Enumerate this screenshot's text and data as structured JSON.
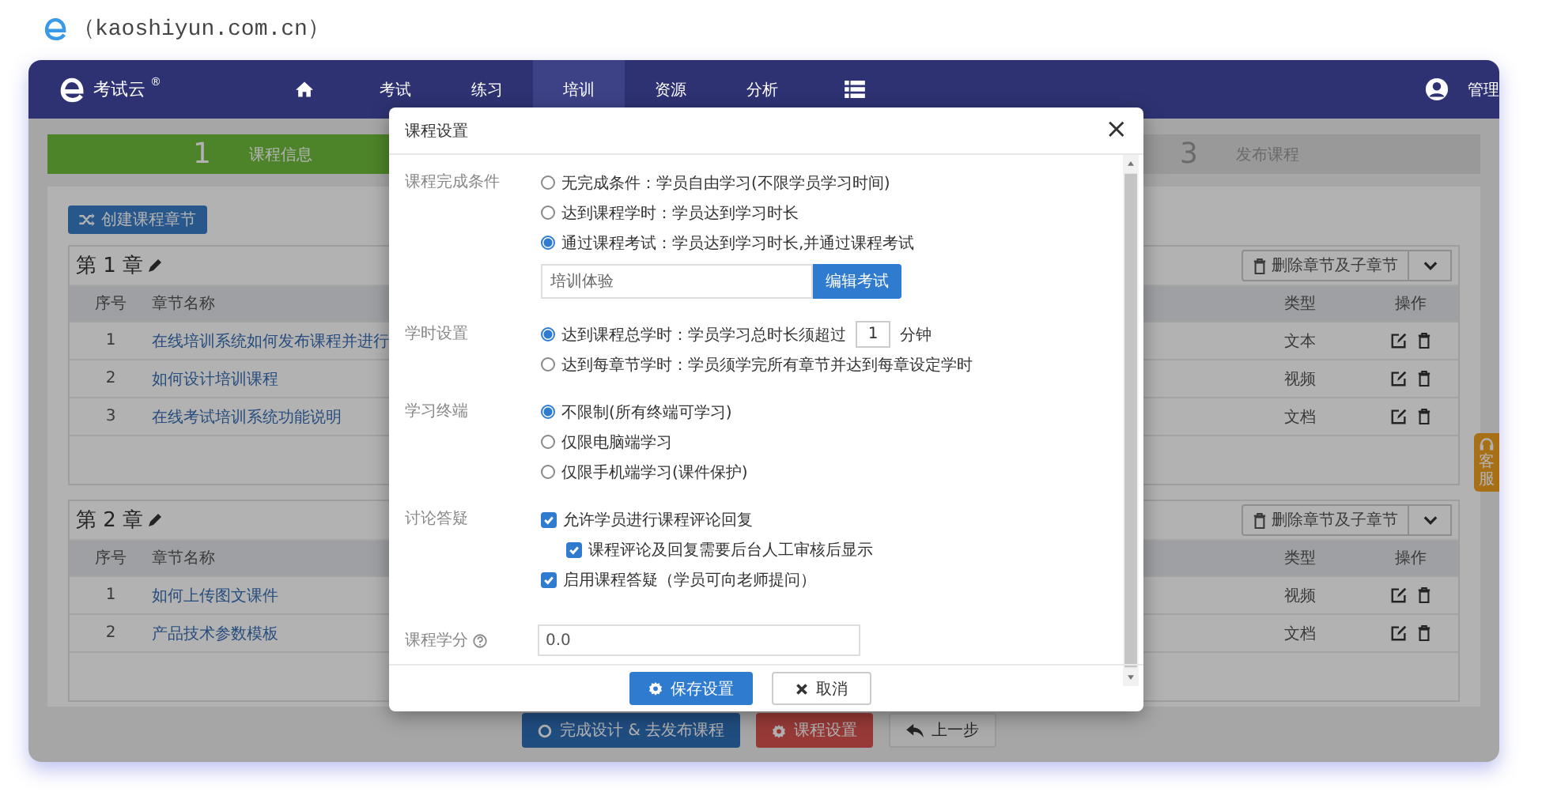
{
  "caption": {
    "text": "（kaoshiyun.com.cn）"
  },
  "navbar": {
    "brand": "考试云",
    "brand_mark": "®",
    "items": [
      {
        "kind": "home",
        "selected": false
      },
      {
        "kind": "text",
        "label": "考试",
        "selected": false
      },
      {
        "kind": "text",
        "label": "练习",
        "selected": false
      },
      {
        "kind": "text",
        "label": "培训",
        "selected": true
      },
      {
        "kind": "text",
        "label": "资源",
        "selected": false
      },
      {
        "kind": "text",
        "label": "分析",
        "selected": false
      },
      {
        "kind": "menu",
        "selected": false
      }
    ],
    "user_label": "管理"
  },
  "steps": [
    {
      "number": "1",
      "label": "课程信息",
      "selected": true
    },
    {
      "number": "3",
      "label": "发布课程",
      "selected": false
    }
  ],
  "create_chapter_button": "创建课程章节",
  "chapters": [
    {
      "title": "第 1 章",
      "delete_button": "删除章节及子章节",
      "columns": [
        "序号",
        "章节名称",
        "类型",
        "操作"
      ],
      "rows": [
        {
          "index": "1",
          "name": "在线培训系统如何发布课程并进行",
          "type": "文本"
        },
        {
          "index": "2",
          "name": "如何设计培训课程",
          "type": "视频"
        },
        {
          "index": "3",
          "name": "在线考试培训系统功能说明",
          "type": "文档"
        }
      ]
    },
    {
      "title": "第 2 章",
      "delete_button": "删除章节及子章节",
      "columns": [
        "序号",
        "章节名称",
        "类型",
        "操作"
      ],
      "rows": [
        {
          "index": "1",
          "name": "如何上传图文课件",
          "type": "视频"
        },
        {
          "index": "2",
          "name": "产品技术参数模板",
          "type": "文档"
        }
      ]
    }
  ],
  "bottom_buttons": [
    {
      "kind": "finish",
      "label": "完成设计 & 去发布课程"
    },
    {
      "kind": "settings",
      "label": "课程设置"
    },
    {
      "kind": "back",
      "label": "上一步"
    }
  ],
  "side_tab": {
    "label": "客服"
  },
  "modal": {
    "title": "课程设置",
    "close": "×",
    "sections": [
      {
        "label": "课程完成条件",
        "options": [
          {
            "kind": "radio",
            "label": "无完成条件：学员自由学习(不限学员学习时间)",
            "selected": false
          },
          {
            "kind": "radio",
            "label": "达到课程学时：学员达到学习时长",
            "selected": false
          },
          {
            "kind": "radio",
            "label": "通过课程考试：学员达到学习时长,并通过课程考试",
            "selected": true
          }
        ],
        "exam": {
          "value": "培训体验",
          "button": "编辑考试"
        }
      },
      {
        "label": "学时设置",
        "options": [
          {
            "kind": "radio",
            "label": "达到课程总学时：学员学习总时长须超过",
            "selected": true,
            "input": "1",
            "suffix": "分钟"
          },
          {
            "kind": "radio",
            "label": "达到每章节学时：学员须学完所有章节并达到每章设定学时",
            "selected": false
          }
        ]
      },
      {
        "label": "学习终端",
        "options": [
          {
            "kind": "radio",
            "label": "不限制(所有终端可学习)",
            "selected": true
          },
          {
            "kind": "radio",
            "label": "仅限电脑端学习",
            "selected": false
          },
          {
            "kind": "radio",
            "label": "仅限手机端学习(课件保护)",
            "selected": false
          }
        ]
      },
      {
        "label": "讨论答疑",
        "options": [
          {
            "kind": "checkbox",
            "label": "允许学员进行课程评论回复",
            "checked": true,
            "children": [
              {
                "kind": "checkbox",
                "label": "课程评论及回复需要后台人工审核后显示",
                "checked": true
              }
            ]
          },
          {
            "kind": "checkbox",
            "label": "启用课程答疑（学员可向老师提问）",
            "checked": true
          }
        ]
      }
    ],
    "credit": {
      "label": "课程学分",
      "value": "0.0"
    },
    "buttons": [
      {
        "kind": "save",
        "label": "保存设置"
      },
      {
        "kind": "cancel",
        "label": "取消"
      }
    ]
  }
}
